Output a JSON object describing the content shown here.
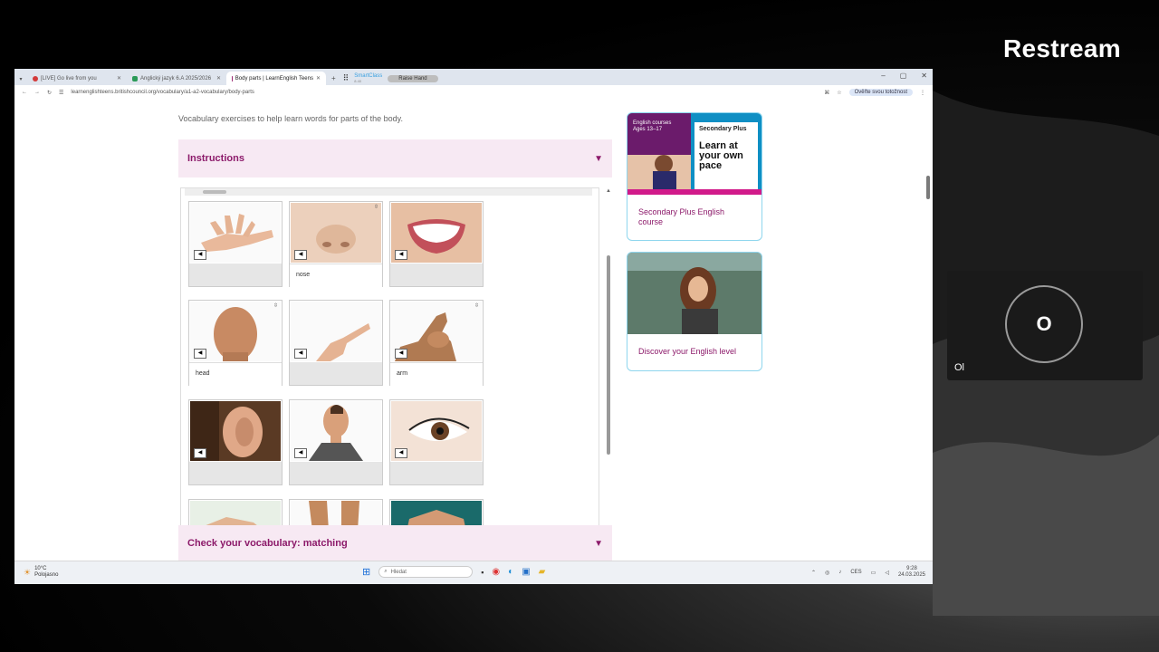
{
  "overlay": {
    "brand": "Restream",
    "participant_initial": "O",
    "participant_name": "Ol",
    "corner_label": "Ol"
  },
  "browser": {
    "tabs": [
      {
        "label": "[LIVE] Go live from you",
        "color": "#d33b3b"
      },
      {
        "label": "Anglický jazyk 6.A 2025/2026",
        "color": "#2b9a58"
      },
      {
        "label": "Body parts | LearnEnglish Teens",
        "color": "#9b2a72",
        "active": true
      }
    ],
    "smartclass_brand": "SmartClass",
    "smartclass_version": "8.40",
    "raise_hand": "Raise Hand",
    "url": "learnenglishteens.britishcouncil.org/vocabulary/a1-a2-vocabulary/body-parts",
    "verify_label": "Ověřte svou totožnost"
  },
  "page": {
    "subtitle": "Vocabulary exercises to help learn words for parts of the body.",
    "instructions_label": "Instructions",
    "check_label": "Check your vocabulary: matching",
    "cards": [
      {
        "word": "",
        "img": "hand"
      },
      {
        "word": "nose",
        "img": "nose"
      },
      {
        "word": "",
        "img": "mouth"
      },
      {
        "word": "head",
        "img": "head"
      },
      {
        "word": "",
        "img": "finger"
      },
      {
        "word": "arm",
        "img": "arm"
      },
      {
        "word": "",
        "img": "ear"
      },
      {
        "word": "",
        "img": "neck"
      },
      {
        "word": "",
        "img": "eye"
      },
      {
        "word": "",
        "img": "foot"
      },
      {
        "word": "",
        "img": "legs"
      },
      {
        "word": "",
        "img": "back"
      }
    ]
  },
  "sidebar": {
    "promo1": {
      "tag_line1": "English courses",
      "tag_line2": "Ages 13–17",
      "badge": "Secondary Plus",
      "headline": "Learn at your own pace",
      "link": "Secondary Plus English course"
    },
    "promo2": {
      "link": "Discover your English level"
    }
  },
  "taskbar": {
    "temp": "10°C",
    "weather": "Polojasno",
    "search_placeholder": "Hledat",
    "lang": "CES",
    "time": "9:28",
    "date": "24.03.2025"
  }
}
